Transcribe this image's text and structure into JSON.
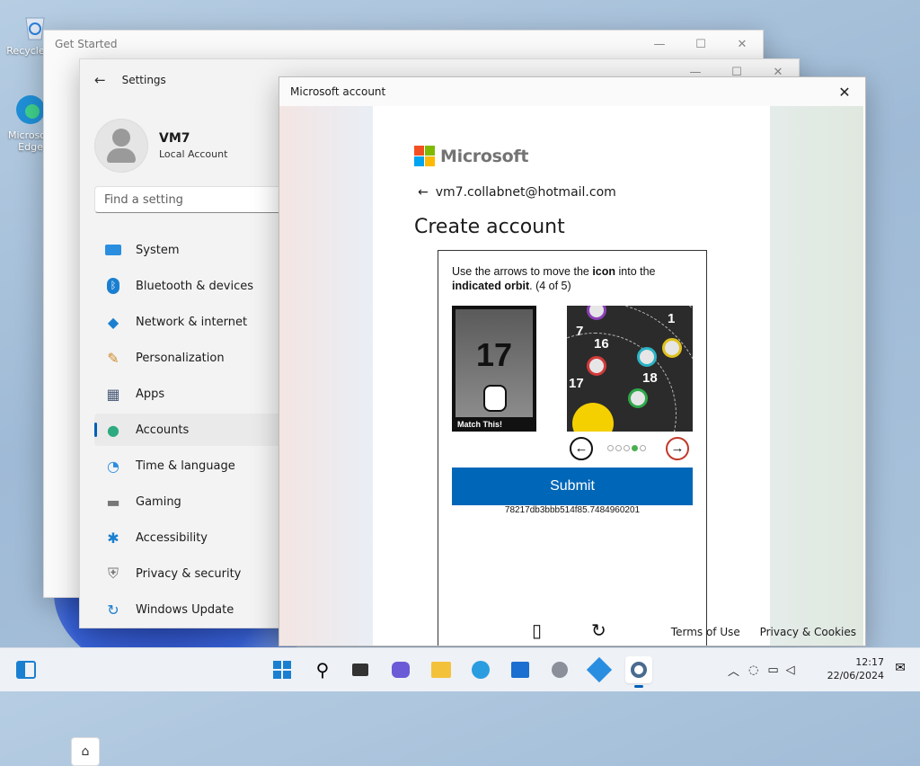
{
  "desktop": {
    "icons": [
      {
        "label": "Recycle Bin",
        "icon": "recycle-bin-icon"
      },
      {
        "label": "Microsoft Edge",
        "icon": "edge-icon"
      }
    ]
  },
  "get_started": {
    "title": "Get Started"
  },
  "settings": {
    "title": "Settings",
    "user": {
      "name": "VM7",
      "account_type": "Local Account"
    },
    "search_placeholder": "Find a setting",
    "nav": [
      {
        "label": "System",
        "icon": "system-icon",
        "active": false
      },
      {
        "label": "Bluetooth & devices",
        "icon": "bluetooth-icon",
        "active": false
      },
      {
        "label": "Network & internet",
        "icon": "wifi-icon",
        "active": false
      },
      {
        "label": "Personalization",
        "icon": "brush-icon",
        "active": false
      },
      {
        "label": "Apps",
        "icon": "apps-icon",
        "active": false
      },
      {
        "label": "Accounts",
        "icon": "person-icon",
        "active": true
      },
      {
        "label": "Time & language",
        "icon": "clock-globe-icon",
        "active": false
      },
      {
        "label": "Gaming",
        "icon": "gamepad-icon",
        "active": false
      },
      {
        "label": "Accessibility",
        "icon": "accessibility-icon",
        "active": false
      },
      {
        "label": "Privacy & security",
        "icon": "shield-icon",
        "active": false
      },
      {
        "label": "Windows Update",
        "icon": "update-icon",
        "active": false
      }
    ]
  },
  "ms_account": {
    "title": "Microsoft account",
    "brand": "Microsoft",
    "email": "vm7.collabnet@hotmail.com",
    "heading": "Create account",
    "captcha": {
      "instruction_pre": "Use the arrows to move the ",
      "instruction_icon": "icon",
      "instruction_mid": " into the ",
      "instruction_orbit": "indicated orbit",
      "instruction_post": ". (4 of 5)",
      "target_number": "17",
      "target_label": "Match This!",
      "orbit_numbers": [
        "7",
        "16",
        "1",
        "17",
        "18"
      ],
      "dots_total": 5,
      "dot_active": 4,
      "submit_label": "Submit",
      "session_id": "78217db3bbb514f85.7484960201"
    },
    "footer": {
      "terms": "Terms of Use",
      "privacy": "Privacy & Cookies"
    }
  },
  "taskbar": {
    "apps": [
      "widgets-icon",
      "start-icon",
      "search-icon",
      "task-view-icon",
      "meet-icon",
      "file-explorer-icon",
      "edge-icon",
      "store-icon",
      "app-icon",
      "app-icon-2",
      "settings-icon"
    ],
    "time": "12:17",
    "date": "22/06/2024"
  },
  "colors": {
    "accent": "#005fb8",
    "submit": "#0067b8",
    "ms_red": "#f25022",
    "ms_green": "#7fba00",
    "ms_blue": "#00a4ef",
    "ms_yellow": "#ffb900"
  }
}
